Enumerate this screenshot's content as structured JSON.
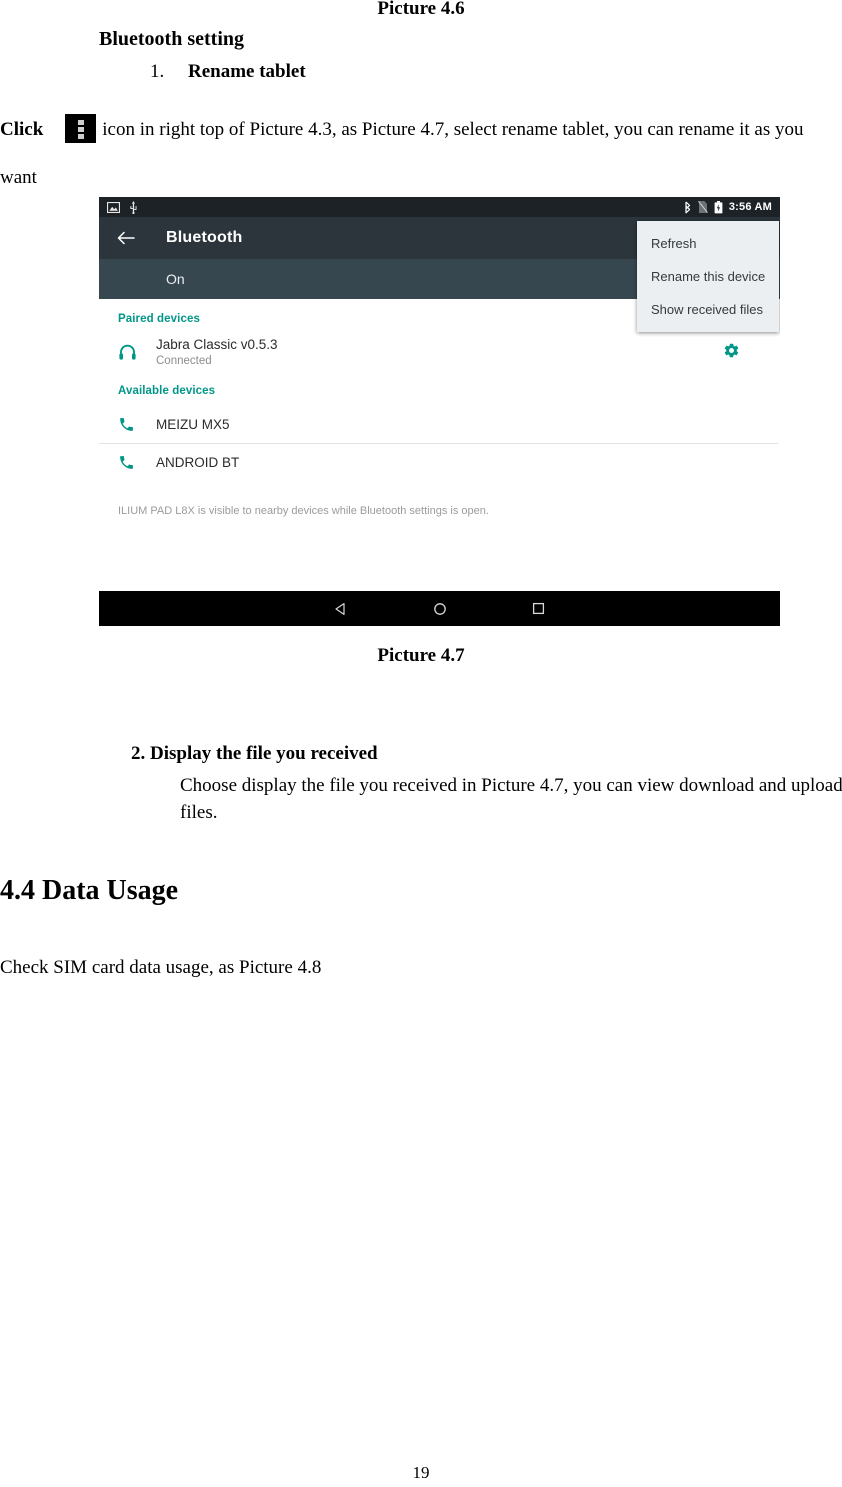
{
  "document": {
    "caption_top": "Picture 4.6",
    "caption_bottom": "Picture 4.7",
    "heading_bluetooth_setting": "Bluetooth setting",
    "list_item_number": "1.",
    "list_item_text": "Rename tablet",
    "paragraph_click_lead": "Click",
    "paragraph_click_rest": "icon in right top of Picture 4.3, as Picture 4.7, select rename tablet, you can rename it as you want",
    "section_2_heading": "2. Display the file you received",
    "section_2_body": "Choose display the file you received in Picture 4.7, you can view download and upload files.",
    "heading_data_usage": "4.4 Data Usage",
    "paragraph_sim": "Check SIM card data usage, as Picture 4.8",
    "page_number": "19",
    "overflow_icon_name": "overflow-menu-icon"
  },
  "screenshot": {
    "statusbar": {
      "left_icons": [
        "screenshot-icon",
        "usb-icon"
      ],
      "right_icons": [
        "bluetooth-icon",
        "no-sim-icon",
        "battery-icon"
      ],
      "time": "3:56 AM"
    },
    "appbar": {
      "back_icon": "back-arrow-icon",
      "title": "Bluetooth"
    },
    "toggle_row": {
      "state_label": "On"
    },
    "overflow_menu": {
      "items": [
        "Refresh",
        "Rename this device",
        "Show received files"
      ]
    },
    "paired_section": {
      "header": "Paired devices",
      "devices": [
        {
          "icon": "headset-icon",
          "name": "Jabra Classic v0.5.3",
          "status": "Connected",
          "settings_icon": "gear-icon"
        }
      ]
    },
    "available_section": {
      "header": "Available devices",
      "devices": [
        {
          "icon": "phone-icon",
          "name": "MEIZU MX5"
        },
        {
          "icon": "phone-icon",
          "name": "ANDROID BT"
        }
      ]
    },
    "visibility_note": "ILIUM PAD L8X is visible to nearby devices while Bluetooth settings is open.",
    "navbar": {
      "back": "nav-back-icon",
      "home": "nav-home-icon",
      "recents": "nav-recents-icon"
    },
    "colors": {
      "statusbar_bg": "#1c2226",
      "appbar_bg": "#2b353b",
      "toggle_bg": "#37474f",
      "accent_teal": "#009688",
      "menu_bg": "#eceff1",
      "navbar_bg": "#000000"
    }
  }
}
